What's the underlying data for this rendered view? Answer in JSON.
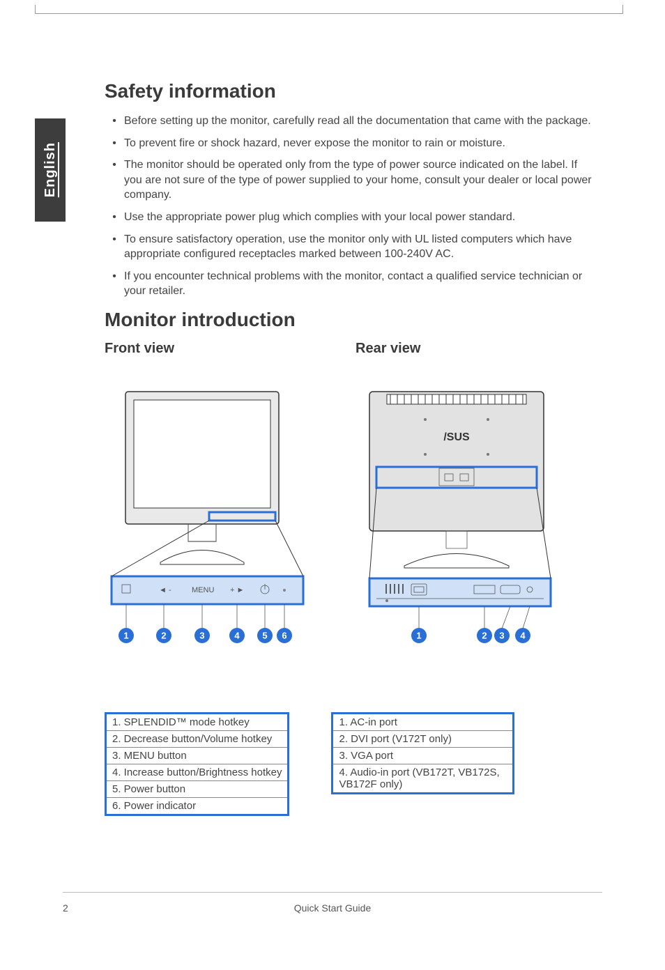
{
  "side_tab": "English",
  "headings": {
    "safety": "Safety information",
    "monitor_intro": "Monitor introduction",
    "front_view": "Front view",
    "rear_view": "Rear view"
  },
  "bullets": [
    "Before setting up the monitor, carefully read all the documentation that came with the package.",
    "To prevent fire or shock hazard, never expose the monitor to rain or moisture.",
    "The monitor should be operated only from the type of power source indicated on the label. If you are not sure of the type of power supplied to your home, consult your dealer or local power company.",
    "Use the appropriate power plug which complies with your local power standard.",
    "To ensure satisfactory operation, use the monitor only with UL listed  computers which have appropriate configured receptacles marked between 100-240V AC.",
    "If you encounter technical problems with the monitor, contact a qualified service technician or your retailer."
  ],
  "diagram": {
    "front_panel_menu": "MENU",
    "brand": "/SUS",
    "front_markers": [
      "1",
      "2",
      "3",
      "4",
      "5",
      "6"
    ],
    "rear_markers": [
      "1",
      "2",
      "3",
      "4"
    ]
  },
  "front_legend": [
    "1. SPLENDID™ mode hotkey",
    "2. Decrease button/Volume hotkey",
    "3. MENU button",
    "4. Increase button/Brightness hotkey",
    "5. Power button",
    "6. Power indicator"
  ],
  "rear_legend": [
    "1. AC-in port",
    "2. DVI port (V172T only)",
    "3. VGA port",
    "4. Audio-in port (VB172T, VB172S, VB172F only)"
  ],
  "footer": {
    "page": "2",
    "title": "Quick Start Guide"
  }
}
